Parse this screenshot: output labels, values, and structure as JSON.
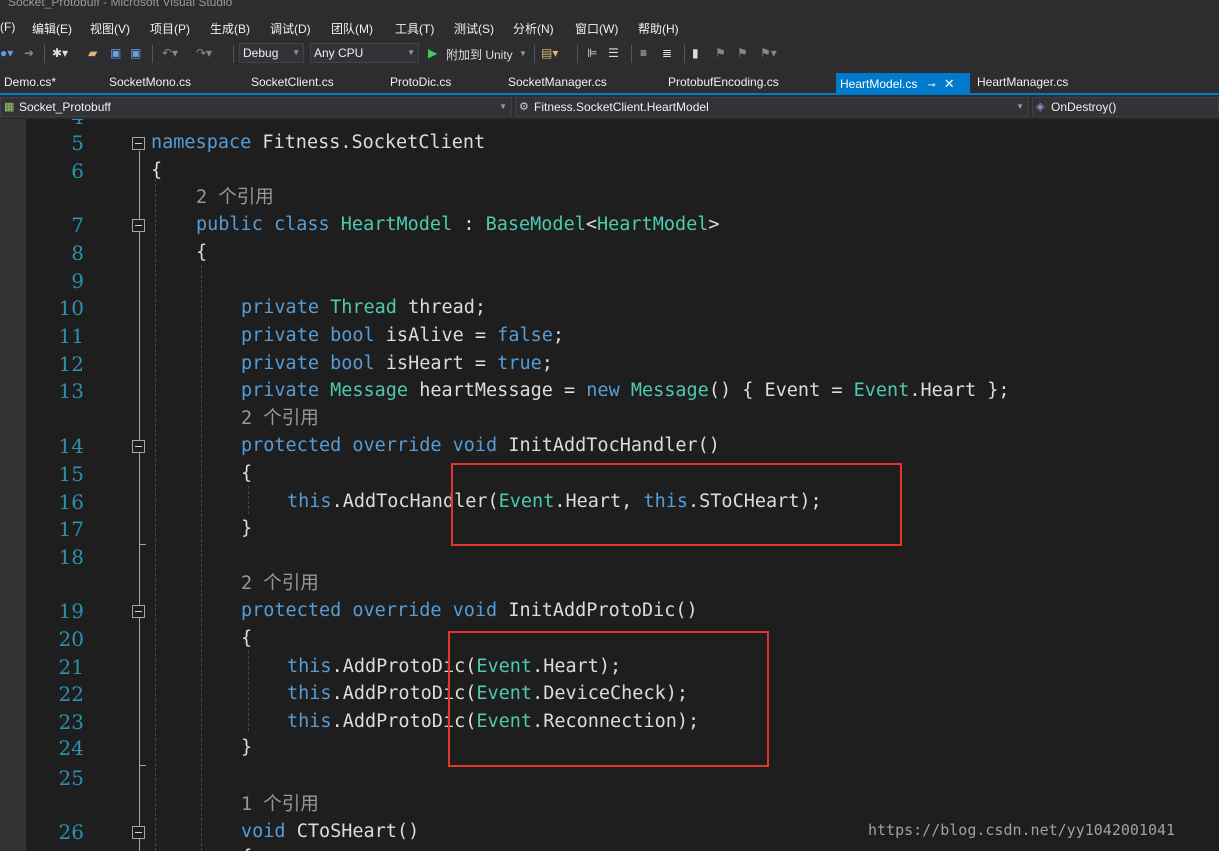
{
  "window": {
    "title": "Socket_Protobuff - Microsoft Visual Studio"
  },
  "menu": [
    "(F)",
    "编辑(E)",
    "视图(V)",
    "项目(P)",
    "生成(B)",
    "调试(D)",
    "团队(M)",
    "工具(T)",
    "测试(S)",
    "分析(N)",
    "窗口(W)",
    "帮助(H)"
  ],
  "toolbar": {
    "config": "Debug",
    "platform": "Any CPU",
    "attach_label": "附加到 Unity"
  },
  "tabs": [
    {
      "label": "Demo.cs*"
    },
    {
      "label": "SocketMono.cs"
    },
    {
      "label": "SocketClient.cs"
    },
    {
      "label": "ProtoDic.cs"
    },
    {
      "label": "SocketManager.cs"
    },
    {
      "label": "ProtobufEncoding.cs"
    },
    {
      "label": "HeartModel.cs"
    },
    {
      "label": "HeartManager.cs"
    }
  ],
  "navbar": {
    "project": "Socket_Protobuff",
    "type": "Fitness.SocketClient.HeartModel",
    "member": "OnDestroy()"
  },
  "editor": {
    "line_numbers": [
      "5",
      "6",
      "7",
      "8",
      "9",
      "10",
      "11",
      "12",
      "13",
      "14",
      "15",
      "16",
      "17",
      "18",
      "19",
      "20",
      "21",
      "22",
      "23",
      "24",
      "25",
      "26"
    ],
    "refs": {
      "ref1": "2 个引用",
      "ref2": "2 个引用",
      "ref3": "2 个引用",
      "ref4": "1 个引用"
    },
    "lines": {
      "l5": [
        "namespace",
        " Fitness.SocketClient"
      ],
      "l6": [
        "{"
      ],
      "l7": [
        "public class ",
        "HeartModel",
        " : ",
        "BaseModel",
        "<",
        "HeartModel",
        ">"
      ],
      "l8": [
        "{"
      ],
      "l10": [
        "private ",
        "Thread",
        " thread;"
      ],
      "l11": [
        "private bool",
        " isAlive = ",
        "false",
        ";"
      ],
      "l12": [
        "private bool",
        " isHeart = ",
        "true",
        ";"
      ],
      "l13": [
        "private ",
        "Message",
        " heartMessage = ",
        "new ",
        "Message",
        "() { Event = ",
        "Event",
        ".Heart };"
      ],
      "l14": [
        "protected override void",
        " InitAddTocHandler()"
      ],
      "l15": [
        "{"
      ],
      "l16": [
        "this",
        ".AddTocHandler(",
        "Event",
        ".Heart, ",
        "this",
        ".SToCHeart);"
      ],
      "l17": [
        "}"
      ],
      "l19": [
        "protected override void",
        " InitAddProtoDic()"
      ],
      "l20": [
        "{"
      ],
      "l21": [
        "this",
        ".AddProtoDic(",
        "Event",
        ".Heart);"
      ],
      "l22": [
        "this",
        ".AddProtoDic(",
        "Event",
        ".DeviceCheck);"
      ],
      "l23": [
        "this",
        ".AddProtoDic(",
        "Event",
        ".Reconnection);"
      ],
      "l24": [
        "}"
      ],
      "l26": [
        "void",
        " CToSHeart()"
      ]
    }
  },
  "watermark": "https://blog.csdn.net/yy1042001041",
  "colors": {
    "accent": "#007acc",
    "highlight_box": "#e0362c",
    "keyword": "#569cd6",
    "type": "#4ec9b0",
    "line_number": "#2b91af"
  }
}
